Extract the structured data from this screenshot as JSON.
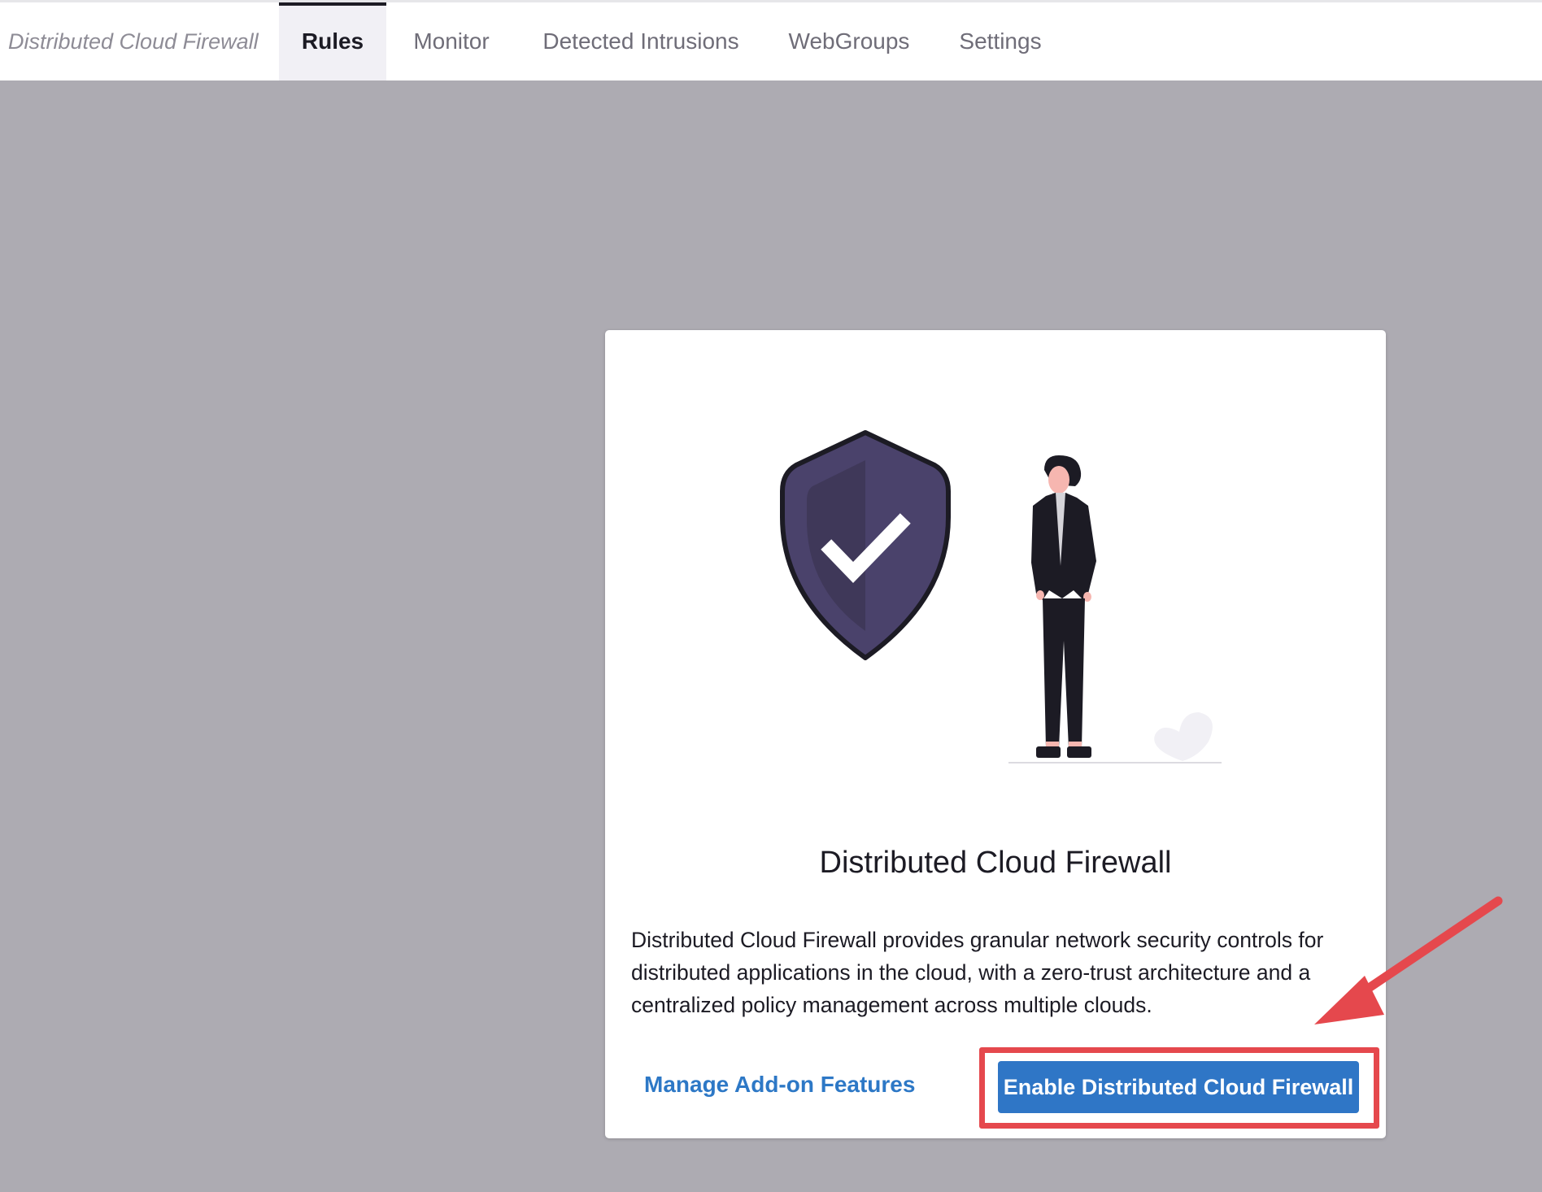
{
  "header": {
    "app_title": "Distributed Cloud Firewall",
    "tabs": [
      {
        "label": "Rules",
        "active": true
      },
      {
        "label": "Monitor",
        "active": false
      },
      {
        "label": "Detected Intrusions",
        "active": false
      },
      {
        "label": "WebGroups",
        "active": false
      },
      {
        "label": "Settings",
        "active": false
      }
    ]
  },
  "card": {
    "illustration": "shield-check-person-illustration",
    "title": "Distributed Cloud Firewall",
    "description": "Distributed Cloud Firewall provides granular network security controls for distributed applications in the cloud, with a zero-trust architecture and a centralized policy management across multiple clouds.",
    "manage_link": "Manage Add-on Features",
    "enable_button": "Enable Distributed Cloud Firewall"
  },
  "annotation": {
    "highlight": "red-box-around-enable-button",
    "arrow": "red-arrow-pointing-to-enable-button"
  },
  "colors": {
    "backdrop": "#adabb2",
    "accent": "#2f76c6",
    "shield": "#4a426b",
    "annotation": "#e5484d",
    "tab_active_bg": "#f1f0f5"
  }
}
